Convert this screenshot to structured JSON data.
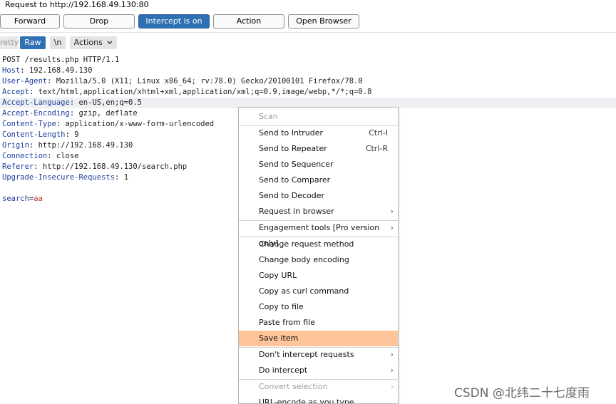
{
  "window": {
    "title": "Request to http://192.168.49.130:80"
  },
  "toolbar": {
    "forward": "Forward",
    "drop": "Drop",
    "intercept": "Intercept is on",
    "action": "Action",
    "open_browser": "Open Browser"
  },
  "tabs": {
    "pretty": "retty",
    "raw": "Raw",
    "newline": "\\n",
    "actions": "Actions"
  },
  "request": {
    "request_line": "POST /results.php HTTP/1.1",
    "headers": [
      {
        "name": "Host",
        "value": "192.168.49.130"
      },
      {
        "name": "User-Agent",
        "value": "Mozilla/5.0 (X11; Linux x86_64; rv:78.0) Gecko/20100101 Firefox/78.0"
      },
      {
        "name": "Accept",
        "value": "text/html,application/xhtml+xml,application/xml;q=0.9,image/webp,*/*;q=0.8"
      },
      {
        "name": "Accept-Language",
        "value": "en-US,en;q=0.5"
      },
      {
        "name": "Accept-Encoding",
        "value": "gzip, deflate"
      },
      {
        "name": "Content-Type",
        "value": "application/x-www-form-urlencoded"
      },
      {
        "name": "Content-Length",
        "value": "9"
      },
      {
        "name": "Origin",
        "value": "http://192.168.49.130"
      },
      {
        "name": "Connection",
        "value": "close"
      },
      {
        "name": "Referer",
        "value": "http://192.168.49.130/search.php"
      },
      {
        "name": "Upgrade-Insecure-Requests",
        "value": "1"
      }
    ],
    "body": {
      "param": "search",
      "eq": "=",
      "value": "aa"
    }
  },
  "context_menu": {
    "items": [
      {
        "label": "Scan",
        "shortcut": "",
        "disabled": true
      },
      {
        "label": "Send to Intruder",
        "shortcut": "Ctrl-I"
      },
      {
        "label": "Send to Repeater",
        "shortcut": "Ctrl-R"
      },
      {
        "label": "Send to Sequencer",
        "shortcut": ""
      },
      {
        "label": "Send to Comparer",
        "shortcut": ""
      },
      {
        "label": "Send to Decoder",
        "shortcut": ""
      },
      {
        "label": "Request in browser",
        "shortcut": "",
        "submenu": true
      },
      {
        "label": "Engagement tools [Pro version only]",
        "shortcut": "",
        "submenu": true
      },
      {
        "label": "Change request method",
        "shortcut": ""
      },
      {
        "label": "Change body encoding",
        "shortcut": ""
      },
      {
        "label": "Copy URL",
        "shortcut": ""
      },
      {
        "label": "Copy as curl command",
        "shortcut": ""
      },
      {
        "label": "Copy to file",
        "shortcut": ""
      },
      {
        "label": "Paste from file",
        "shortcut": ""
      },
      {
        "label": "Save item",
        "shortcut": "",
        "selected": true
      },
      {
        "label": "Don't intercept requests",
        "shortcut": "",
        "submenu": true
      },
      {
        "label": "Do intercept",
        "shortcut": "",
        "submenu": true
      },
      {
        "label": "Convert selection",
        "shortcut": "",
        "submenu": true,
        "disabled": true
      },
      {
        "label": "URL-encode as you type",
        "shortcut": ""
      }
    ]
  },
  "watermark": "CSDN @北纬二十七度雨",
  "colors": {
    "accent": "#2f6fb3",
    "menu_highlight": "#ffc499",
    "header_key": "#1f3f9e",
    "param_value": "#c0392b"
  }
}
